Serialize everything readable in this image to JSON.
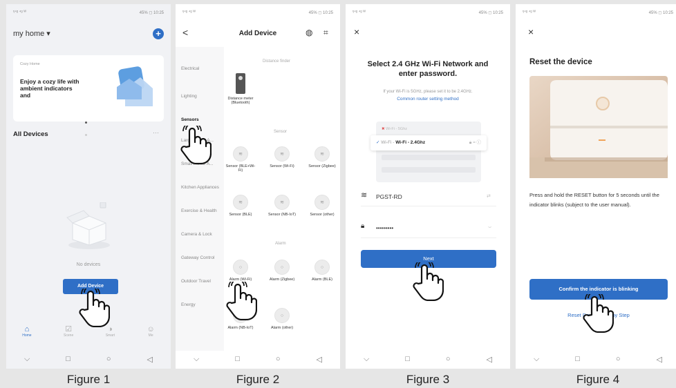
{
  "colors": {
    "accent": "#2f6fc6",
    "screen_bg": "#f1f2f5",
    "outer_bg": "#e6e6e6"
  },
  "status": {
    "left": "ᵑ⁴ᵍ ⁴ᵍ ᵂ",
    "right": "45% ◻ 10:25"
  },
  "nav": {
    "back": "⌵",
    "home": "□",
    "circle": "○",
    "recent": "◁"
  },
  "figure1": {
    "caption": "Figure 1",
    "home_title": "my home ▾",
    "add_icon": "plus-icon",
    "banner_small": "Cozy Home",
    "banner_text": "Enjoy a cozy life with ambient indicators and",
    "all_devices": "All Devices",
    "more": "···",
    "no_devices": "No devices",
    "add_device_button": "Add Device",
    "tabs": [
      {
        "label": "Home",
        "icon": "⌂"
      },
      {
        "label": "Scene",
        "icon": "☑"
      },
      {
        "label": "Smart",
        "icon": "◑"
      },
      {
        "label": "Me",
        "icon": "☺"
      }
    ]
  },
  "figure2": {
    "caption": "Figure 2",
    "title": "Add Device",
    "back": "<",
    "icon_globe": "◍",
    "icon_scan": "⌗",
    "categories": [
      "Electrical",
      "Lighting",
      "Sensors",
      "Large Home A...",
      "Small Home A...",
      "Kitchen Appliances",
      "Exercise & Health",
      "Camera & Lock",
      "Gateway Control",
      "Outdoor Travel",
      "Energy"
    ],
    "distance_finder": "Distance finder",
    "distance_device": "Distance meter (Bluetooth)",
    "sensor_head": "Sensor",
    "sensors": [
      "Sensor (BLE+Wi-Fi)",
      "Sensor (Wi-Fi)",
      "Sensor (Zigbee)",
      "Sensor (BLE)",
      "Sensor (NB-IoT)",
      "Sensor (other)"
    ],
    "alarm_head": "Alarm",
    "alarms": [
      "Alarm (Wi-Fi)",
      "Alarm (Zigbee)",
      "Alarm (BLE)",
      "Alarm (NB-IoT)",
      "Alarm (other)"
    ]
  },
  "figure3": {
    "caption": "Figure 3",
    "close": "×",
    "heading": "Select 2.4 GHz Wi-Fi Network and enter password.",
    "note": "If your Wi-Fi is 5GHz, please set it to be 2.4GHz.",
    "link": "Common router setting method",
    "net_5g": "Wi-Fi - 5Ghz",
    "net_24g": "Wi-Fi - 2.4Ghz",
    "ssid": "PGST-RD",
    "ssid_suffix": "⇄",
    "password": "•••••••••",
    "pw_suffix": "⌣",
    "next_button": "Next"
  },
  "figure4": {
    "caption": "Figure 4",
    "close": "×",
    "heading": "Reset the device",
    "instruction": "Press and hold the RESET button for 5 seconds until the indicator blinks (subject to the user manual).",
    "confirm_button": "Confirm the indicator is blinking",
    "step_link": "Reset Device Step by Step"
  }
}
